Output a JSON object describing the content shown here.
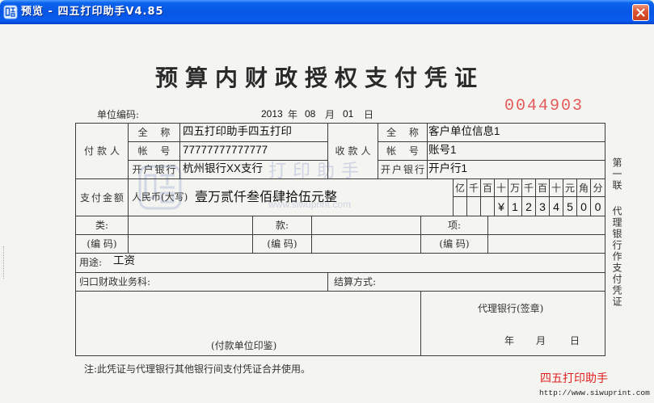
{
  "window": {
    "title": "预览 - 四五打印助手V4.85",
    "app_icon": "app-logo-icon",
    "close_icon": "close-icon",
    "title_bar_color": "#0a58e8",
    "close_button_color": "#d2452a"
  },
  "form": {
    "title": "预算内财政授权支付凭证",
    "unit_code_label": "单位编码:",
    "date": {
      "year": "2013",
      "year_label": "年",
      "month": "08",
      "month_label": "月",
      "day": "01",
      "day_label": "日"
    },
    "serial_number": "0044903",
    "serial_number_color": "#e45a5a",
    "payer": {
      "label": "付款人",
      "name_label": "全 称",
      "name": "四五打印助手四五打印",
      "account_label": "帐 号",
      "account": "77777777777777",
      "bank_label": "开户银行",
      "bank": "杭州银行XX支行"
    },
    "payee": {
      "label": "收款人",
      "name_label": "全 称",
      "name": "客户单位信息1",
      "account_label": "帐 号",
      "account": "账号1",
      "bank_label": "开户银行",
      "bank": "开户行1"
    },
    "amount": {
      "label": "支付金额",
      "rmb_label": "人民币(大写)",
      "in_words": "壹万贰仟叁佰肆拾伍元整",
      "units": [
        "亿",
        "千",
        "百",
        "十",
        "万",
        "千",
        "百",
        "十",
        "元",
        "角",
        "分"
      ],
      "digits": [
        "",
        "",
        "",
        "¥",
        "1",
        "2",
        "3",
        "4",
        "5",
        "0",
        "0"
      ]
    },
    "classification": {
      "category_label": "类:",
      "section_label": "款:",
      "item_label": "项:",
      "code_label": "(编 码)"
    },
    "purpose": {
      "label": "用途:",
      "value": "工资"
    },
    "finance_dept_label": "归口财政业务科:",
    "settlement_label": "结算方式:",
    "payer_seal_label": "(付款单位印鉴)",
    "agent_bank": {
      "seal_label": "代理银行(签章)",
      "year_label": "年",
      "month_label": "月",
      "day_label": "日"
    },
    "copy": {
      "number": "第一联",
      "purpose": "代理银行作支付凭证"
    },
    "note": "注:此凭证与代理银行其他银行间支付凭证合并使用。",
    "watermark": {
      "text": "打印助手",
      "url": "www.siwuprint.com"
    }
  },
  "footer": {
    "brand": "四五打印助手",
    "brand_color": "#e02020",
    "url": "http://www.siwuprint.com"
  }
}
